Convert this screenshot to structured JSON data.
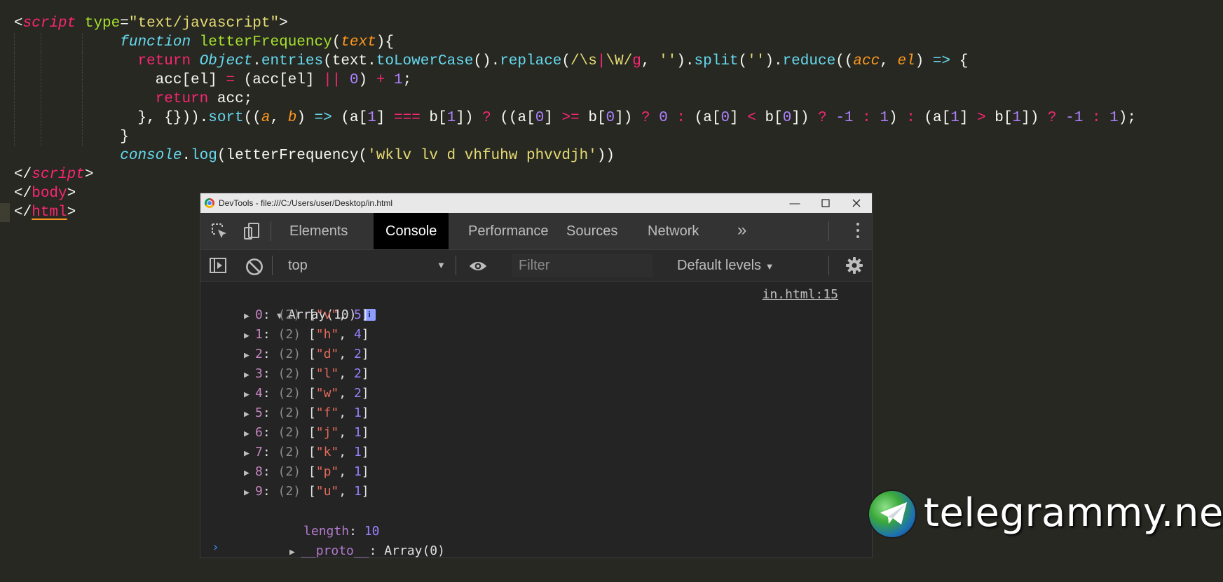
{
  "editor": {
    "lines": [
      [
        [
          "wh",
          "<"
        ],
        [
          "pk it",
          "script"
        ],
        [
          "wh",
          " "
        ],
        [
          "gr",
          "type"
        ],
        [
          "wh",
          "="
        ],
        [
          "ye",
          "\"text/javascript\""
        ],
        [
          "wh",
          ">"
        ]
      ],
      [
        [
          "wh",
          "            "
        ],
        [
          "cy it",
          "function"
        ],
        [
          "wh",
          " "
        ],
        [
          "gr",
          "letterFrequency"
        ],
        [
          "wh",
          "("
        ],
        [
          "or it",
          "text"
        ],
        [
          "wh",
          "){"
        ]
      ],
      [
        [
          "wh",
          "              "
        ],
        [
          "pk",
          "return"
        ],
        [
          "wh",
          " "
        ],
        [
          "cy it",
          "Object"
        ],
        [
          "wh",
          "."
        ],
        [
          "cy",
          "entries"
        ],
        [
          "wh",
          "(text."
        ],
        [
          "cy",
          "toLowerCase"
        ],
        [
          "wh",
          "()."
        ],
        [
          "cy",
          "replace"
        ],
        [
          "wh",
          "("
        ],
        [
          "ye",
          "/\\s"
        ],
        [
          "pk",
          "|"
        ],
        [
          "ye",
          "\\W/"
        ],
        [
          "pk",
          "g"
        ],
        [
          "wh",
          ", "
        ],
        [
          "ye",
          "''"
        ],
        [
          "wh",
          ")."
        ],
        [
          "cy",
          "split"
        ],
        [
          "wh",
          "("
        ],
        [
          "ye",
          "''"
        ],
        [
          "wh",
          ")."
        ],
        [
          "cy",
          "reduce"
        ],
        [
          "wh",
          "(("
        ],
        [
          "or it",
          "acc"
        ],
        [
          "wh",
          ", "
        ],
        [
          "or it",
          "el"
        ],
        [
          "wh",
          ") "
        ],
        [
          "cy",
          "=>"
        ],
        [
          "wh",
          " {"
        ]
      ],
      [
        [
          "wh",
          "                acc[el] "
        ],
        [
          "pk",
          "="
        ],
        [
          "wh",
          " (acc[el] "
        ],
        [
          "pk",
          "||"
        ],
        [
          "wh",
          " "
        ],
        [
          "pu",
          "0"
        ],
        [
          "wh",
          ") "
        ],
        [
          "pk",
          "+"
        ],
        [
          "wh",
          " "
        ],
        [
          "pu",
          "1"
        ],
        [
          "wh",
          ";"
        ]
      ],
      [
        [
          "wh",
          "                "
        ],
        [
          "pk",
          "return"
        ],
        [
          "wh",
          " acc;"
        ]
      ],
      [
        [
          "wh",
          "              }, {}))."
        ],
        [
          "cy",
          "sort"
        ],
        [
          "wh",
          "(("
        ],
        [
          "or it",
          "a"
        ],
        [
          "wh",
          ", "
        ],
        [
          "or it",
          "b"
        ],
        [
          "wh",
          ") "
        ],
        [
          "cy",
          "=>"
        ],
        [
          "wh",
          " (a["
        ],
        [
          "pu",
          "1"
        ],
        [
          "wh",
          "] "
        ],
        [
          "pk",
          "==="
        ],
        [
          "wh",
          " b["
        ],
        [
          "pu",
          "1"
        ],
        [
          "wh",
          "]) "
        ],
        [
          "pk",
          "?"
        ],
        [
          "wh",
          " ((a["
        ],
        [
          "pu",
          "0"
        ],
        [
          "wh",
          "] "
        ],
        [
          "pk",
          ">="
        ],
        [
          "wh",
          " b["
        ],
        [
          "pu",
          "0"
        ],
        [
          "wh",
          "]) "
        ],
        [
          "pk",
          "?"
        ],
        [
          "wh",
          " "
        ],
        [
          "pu",
          "0"
        ],
        [
          "wh",
          " "
        ],
        [
          "pk",
          ":"
        ],
        [
          "wh",
          " (a["
        ],
        [
          "pu",
          "0"
        ],
        [
          "wh",
          "] "
        ],
        [
          "pk",
          "<"
        ],
        [
          "wh",
          " b["
        ],
        [
          "pu",
          "0"
        ],
        [
          "wh",
          "]) "
        ],
        [
          "pk",
          "?"
        ],
        [
          "wh",
          " "
        ],
        [
          "pu",
          "-1"
        ],
        [
          "wh",
          " "
        ],
        [
          "pk",
          ":"
        ],
        [
          "wh",
          " "
        ],
        [
          "pu",
          "1"
        ],
        [
          "wh",
          ") "
        ],
        [
          "pk",
          ":"
        ],
        [
          "wh",
          " (a["
        ],
        [
          "pu",
          "1"
        ],
        [
          "wh",
          "] "
        ],
        [
          "pk",
          ">"
        ],
        [
          "wh",
          " b["
        ],
        [
          "pu",
          "1"
        ],
        [
          "wh",
          "]) "
        ],
        [
          "pk",
          "?"
        ],
        [
          "wh",
          " "
        ],
        [
          "pu",
          "-1"
        ],
        [
          "wh",
          " "
        ],
        [
          "pk",
          ":"
        ],
        [
          "wh",
          " "
        ],
        [
          "pu",
          "1"
        ],
        [
          "wh",
          ");"
        ]
      ],
      [
        [
          "wh",
          "            }"
        ]
      ],
      [
        [
          "wh",
          "            "
        ],
        [
          "cy it",
          "console"
        ],
        [
          "wh",
          "."
        ],
        [
          "cy",
          "log"
        ],
        [
          "wh",
          "(letterFrequency("
        ],
        [
          "ye",
          "'wklv lv d vhfuhw phvvdjh'"
        ],
        [
          "wh",
          "))"
        ]
      ],
      [
        [
          "wh",
          "</"
        ],
        [
          "pk it",
          "script"
        ],
        [
          "wh",
          ">"
        ]
      ],
      [
        [
          "wh",
          "</"
        ],
        [
          "pk",
          "body"
        ],
        [
          "wh",
          ">"
        ]
      ],
      [
        [
          "wh",
          "</"
        ],
        [
          "pk ul",
          "html"
        ],
        [
          "wh",
          ">"
        ]
      ]
    ]
  },
  "devtools": {
    "title": "DevTools - file:///C:/Users/user/Desktop/in.html",
    "tabs": [
      "Elements",
      "Console",
      "Performance",
      "Sources",
      "Network"
    ],
    "more_tabs": "»",
    "context": "top",
    "filter_placeholder": "Filter",
    "levels": "Default levels"
  },
  "console": {
    "array_label": "Array(10)",
    "info_badge": "i",
    "source_link": "in.html:15",
    "items": [
      {
        "index": "0",
        "len": "(2)",
        "letter": "\"v\"",
        "count": "5"
      },
      {
        "index": "1",
        "len": "(2)",
        "letter": "\"h\"",
        "count": "4"
      },
      {
        "index": "2",
        "len": "(2)",
        "letter": "\"d\"",
        "count": "2"
      },
      {
        "index": "3",
        "len": "(2)",
        "letter": "\"l\"",
        "count": "2"
      },
      {
        "index": "4",
        "len": "(2)",
        "letter": "\"w\"",
        "count": "2"
      },
      {
        "index": "5",
        "len": "(2)",
        "letter": "\"f\"",
        "count": "1"
      },
      {
        "index": "6",
        "len": "(2)",
        "letter": "\"j\"",
        "count": "1"
      },
      {
        "index": "7",
        "len": "(2)",
        "letter": "\"k\"",
        "count": "1"
      },
      {
        "index": "8",
        "len": "(2)",
        "letter": "\"p\"",
        "count": "1"
      },
      {
        "index": "9",
        "len": "(2)",
        "letter": "\"u\"",
        "count": "1"
      }
    ],
    "length_key": "length",
    "length_value": "10",
    "proto_key": "__proto__",
    "proto_value": "Array(0)",
    "prompt": "›"
  },
  "watermark": {
    "text": "telegrammy.net",
    "logo": "telegram-globe-logo"
  }
}
